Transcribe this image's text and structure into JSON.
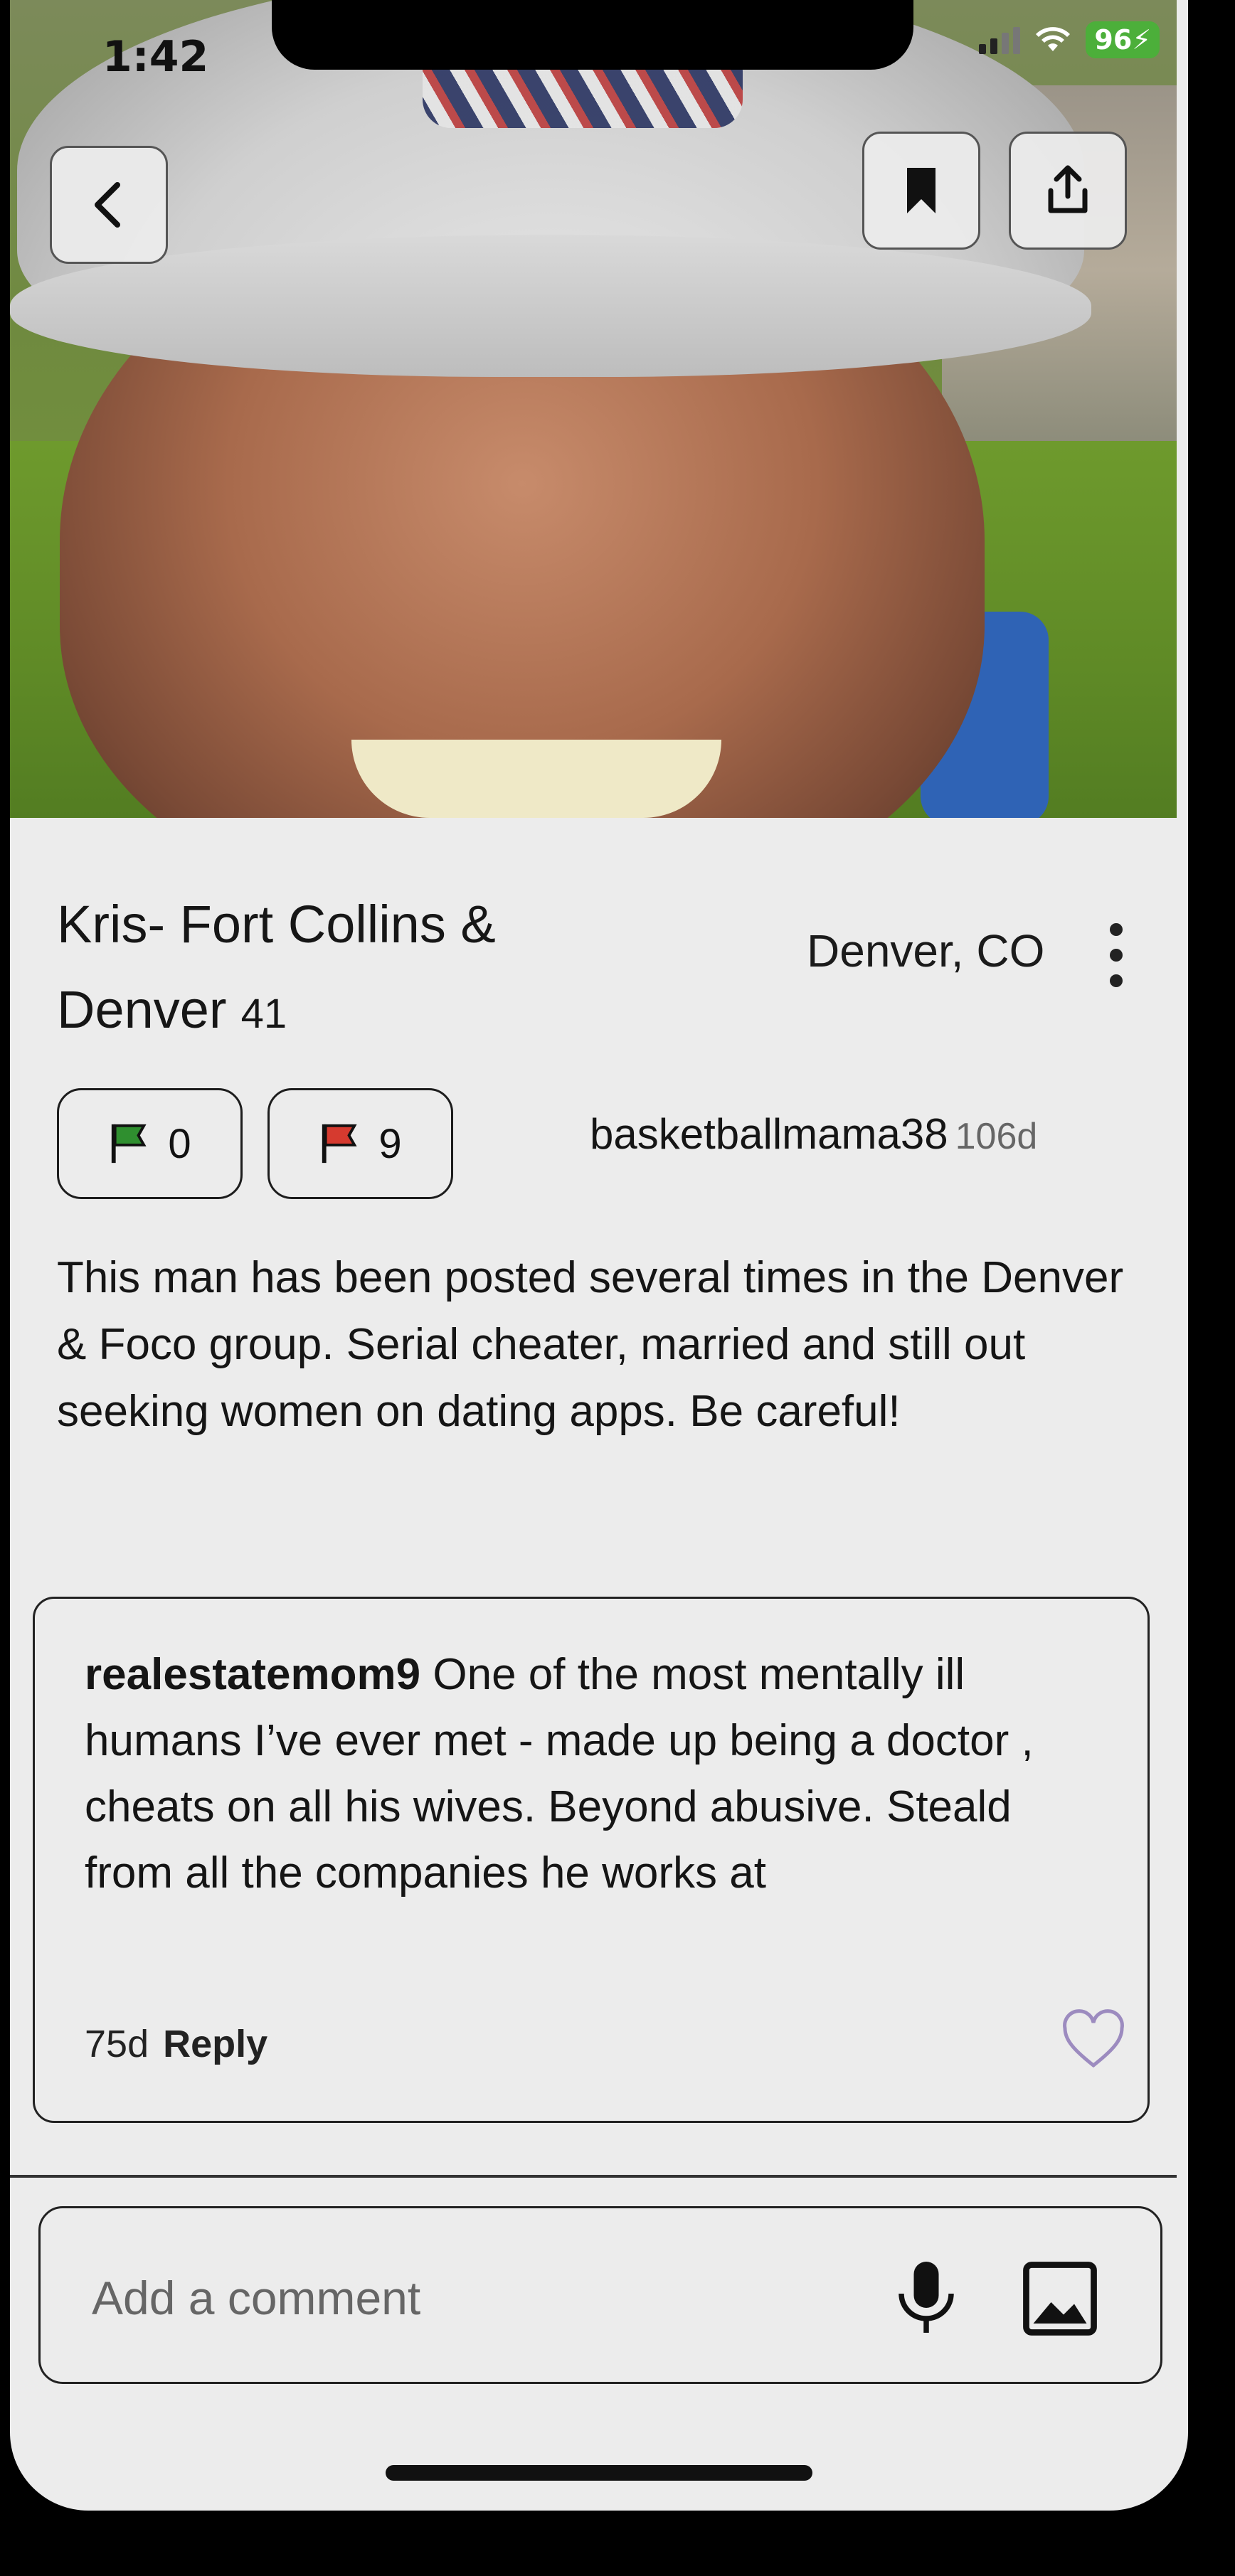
{
  "status_bar": {
    "time": "1:42",
    "battery": "96"
  },
  "colors": {
    "good_flag": "#2f8f2f",
    "red_flag": "#d63a2f",
    "battery": "#4caf3a",
    "heart_outline": "#9c8bbf"
  },
  "profile": {
    "name": "Kris- Fort Collins & Denver",
    "age": "41",
    "location": "Denver, CO",
    "green_flags": "0",
    "red_flags": "9",
    "posted_by": "basketballmama38",
    "posted_ago": "106d",
    "description": "This man has been posted several times in the Denver & Foco group. Serial cheater, married and still out seeking women on dating apps. Be careful!"
  },
  "comments": [
    {
      "user": "realestatemom9",
      "text": "One of the most mentally ill humans I’ve ever met - made up being a doctor , cheats on all his wives. Beyond abusive. Steald from all the companies he works at",
      "age": "75d",
      "reply_label": "Reply"
    }
  ],
  "comment_input": {
    "placeholder": "Add a comment"
  },
  "icons": {
    "back": "chevron-left-icon",
    "bookmark": "bookmark-icon",
    "share": "share-icon",
    "more": "more-vertical-icon",
    "good_flag": "flag-icon",
    "red_flag": "flag-icon",
    "like": "heart-icon",
    "mic": "microphone-icon",
    "image": "image-icon"
  }
}
